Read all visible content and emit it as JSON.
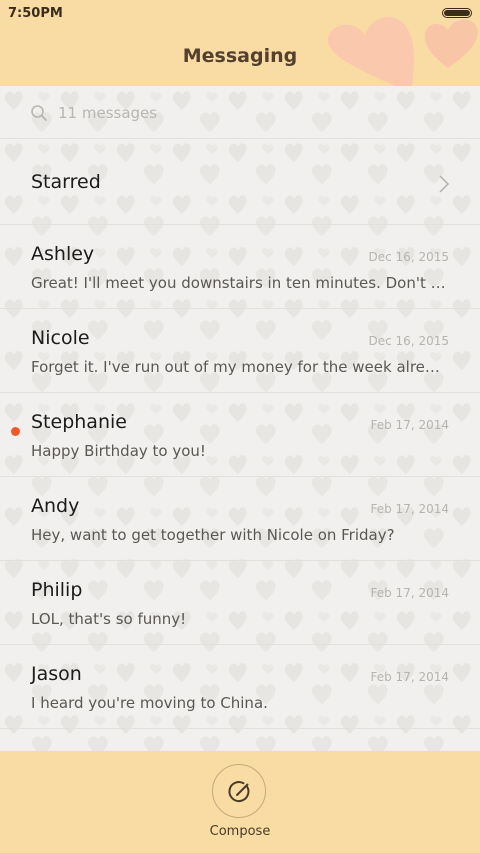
{
  "status_bar": {
    "time": "7:50PM"
  },
  "header": {
    "title": "Messaging"
  },
  "search": {
    "placeholder": "11 messages"
  },
  "starred": {
    "label": "Starred"
  },
  "messages": [
    {
      "name": "Ashley",
      "date": "Dec 16, 2015",
      "preview": "Great! I'll meet you downstairs in ten minutes. Don't forget",
      "unread": false
    },
    {
      "name": "Nicole",
      "date": "Dec 16, 2015",
      "preview": "Forget it. I've run out of my money for the week already.",
      "unread": false
    },
    {
      "name": "Stephanie",
      "date": "Feb 17, 2014",
      "preview": "Happy Birthday to you!",
      "unread": true
    },
    {
      "name": "Andy",
      "date": "Feb 17, 2014",
      "preview": "Hey, want to get together with Nicole on Friday?",
      "unread": false
    },
    {
      "name": "Philip",
      "date": "Feb 17, 2014",
      "preview": "LOL, that's so funny!",
      "unread": false
    },
    {
      "name": "Jason",
      "date": "Feb 17, 2014",
      "preview": "I heard you're moving to China.",
      "unread": false
    }
  ],
  "footer": {
    "compose_label": "Compose"
  },
  "colors": {
    "header_bg": "#f9dba4",
    "unread_dot": "#f0582a",
    "hearts_pink": "#f9c1a8"
  },
  "icons": {
    "search": "search-icon",
    "chevron": "chevron-right-icon",
    "compose": "compose-icon",
    "battery": "battery-icon"
  }
}
